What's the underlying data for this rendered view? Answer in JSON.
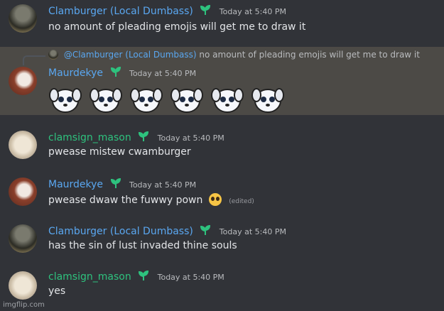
{
  "messages": [
    {
      "user": "Clamburger (Local Dumbass)",
      "time": "Today at 5:40 PM",
      "text": "no amount of pleading emojis will get me to draw it"
    },
    {
      "reply": {
        "mention": "@Clamburger (Local Dumbass)",
        "text": "no amount of pleading emojis will get me to draw it"
      },
      "user": "Maurdekye",
      "time": "Today at 5:40 PM",
      "emoji_count": 6,
      "emoji_icon": "pleading-dog-emoji"
    },
    {
      "user": "clamsign_mason",
      "time": "Today at 5:40 PM",
      "text": "pwease mistew cwamburger"
    },
    {
      "user": "Maurdekye",
      "time": "Today at 5:40 PM",
      "text": "pwease dwaw the fuwwy pown",
      "emoji": "pleading-face-icon",
      "edited": "(edited)"
    },
    {
      "user": "Clamburger (Local Dumbass)",
      "time": "Today at 5:40 PM",
      "text": "has the sin of lust invaded thine souls"
    },
    {
      "user": "clamsign_mason",
      "time": "Today at 5:40 PM",
      "text": "yes"
    }
  ],
  "badge_icon": "sprout-icon",
  "watermark": "imgflip.com",
  "colors": {
    "background": "#313338",
    "highlight": "#4c4a46",
    "blue_name": "#5aa7f0",
    "green_name": "#2ec27e"
  }
}
